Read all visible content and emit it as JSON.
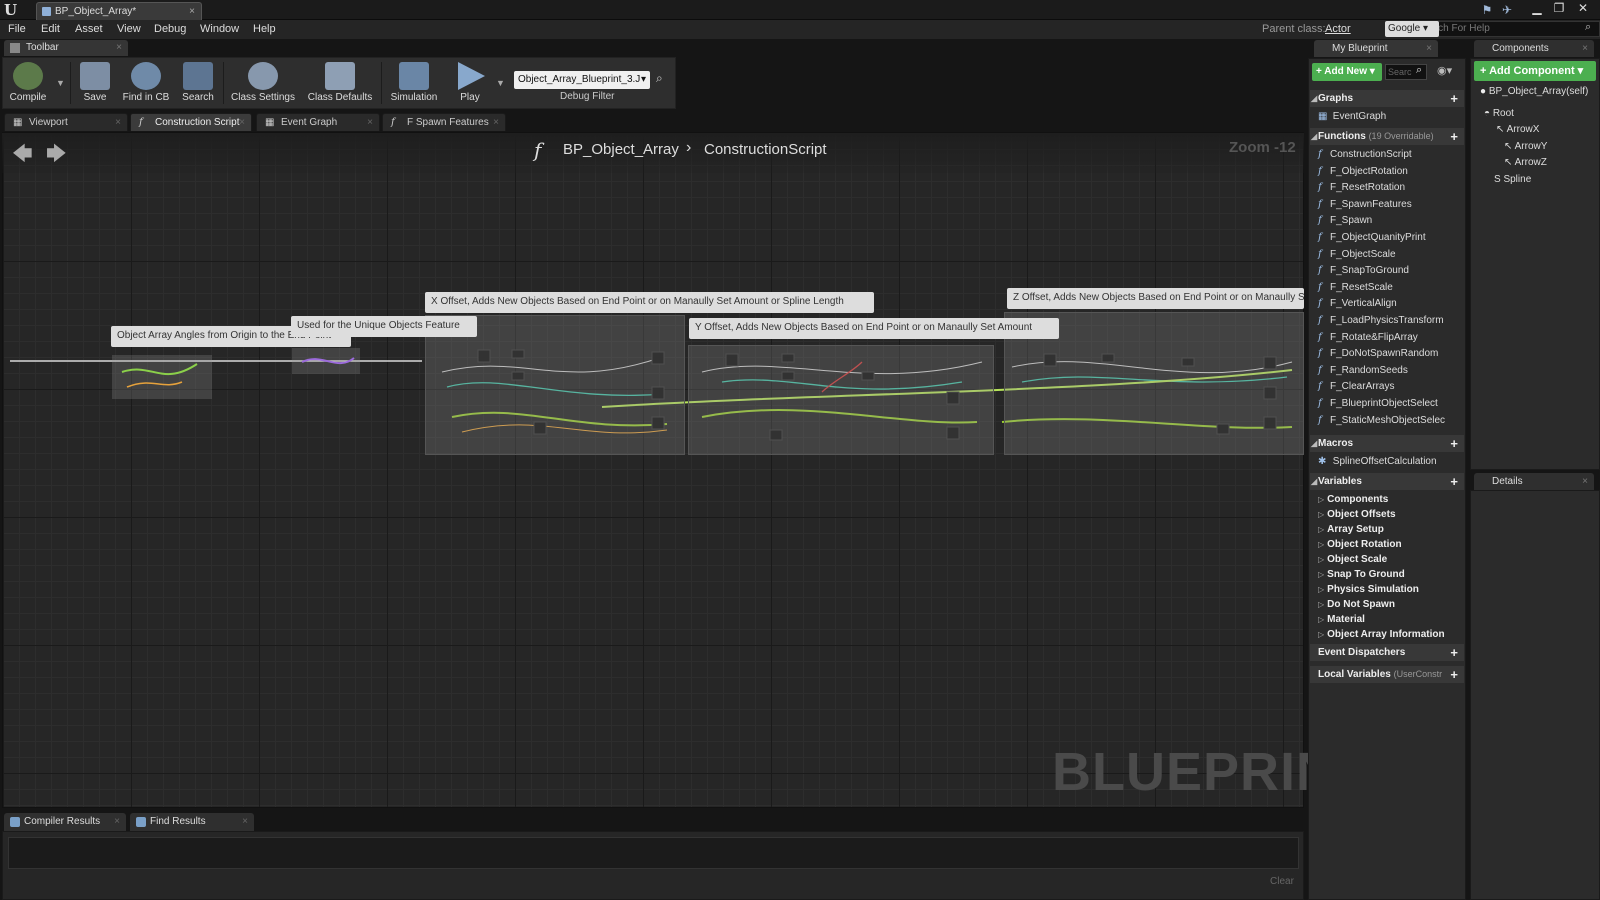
{
  "titlebar": {
    "doc_tab": "BP_Object_Array*",
    "doc_tab_close": "×",
    "minimize": "▁",
    "restore": "❐",
    "close": "✕"
  },
  "menu": [
    "File",
    "Edit",
    "Asset",
    "View",
    "Debug",
    "Window",
    "Help"
  ],
  "parent_class": {
    "label": "Parent class:",
    "value": "Actor"
  },
  "search_engine": "Google ▾",
  "help_search_placeholder": "Search For Help",
  "toolbar_tab": "Toolbar",
  "toolbar": {
    "compile": "Compile",
    "save": "Save",
    "find_in_cb": "Find in CB",
    "search": "Search",
    "class_settings": "Class Settings",
    "class_defaults": "Class Defaults",
    "simulation": "Simulation",
    "play": "Play",
    "debug_object": "Object_Array_Blueprint_3.J",
    "debug_filter": "Debug Filter"
  },
  "doc_tabs": [
    {
      "label": "Viewport",
      "icon": "viewport-icon"
    },
    {
      "label": "Construction Script",
      "icon": "function-icon"
    },
    {
      "label": "Event Graph",
      "icon": "graph-icon"
    },
    {
      "label": "F Spawn Features",
      "icon": "function-icon"
    }
  ],
  "graph": {
    "blueprint_name": "BP_Object_Array",
    "function_name": "ConstructionScript",
    "zoom": "Zoom -12",
    "watermark": "BLUEPRINT",
    "comments": [
      "Object Array Angles from Origin to the End Point",
      "Used for the Unique Objects Feature",
      "X Offset, Adds New Objects Based on End Point or on Manaully Set Amount or Spline Length",
      "Y Offset, Adds New Objects Based on End Point or on Manaully Set Amount",
      "Z Offset, Adds New Objects Based on End Point or on Manaully Set Amount"
    ]
  },
  "bottom_tabs": [
    "Compiler Results",
    "Find Results"
  ],
  "bottom_clear": "Clear",
  "my_blueprint": {
    "tab": "My Blueprint",
    "add_new": "+ Add New ▾",
    "search_placeholder": "Searc",
    "graphs_header": "Graphs",
    "graphs": [
      "EventGraph"
    ],
    "functions_header": "Functions",
    "functions_sub": "(19 Overridable)",
    "functions": [
      "ConstructionScript",
      "F_ObjectRotation",
      "F_ResetRotation",
      "F_SpawnFeatures",
      "F_Spawn",
      "F_ObjectQuanityPrint",
      "F_ObjectScale",
      "F_SnapToGround",
      "F_ResetScale",
      "F_VerticalAlign",
      "F_LoadPhysicsTransform",
      "F_Rotate&FlipArray",
      "F_DoNotSpawnRandom",
      "F_RandomSeeds",
      "F_ClearArrays",
      "F_BlueprintObjectSelect",
      "F_StaticMeshObjectSelec"
    ],
    "macros_header": "Macros",
    "macros": [
      "SplineOffsetCalculation"
    ],
    "variables_header": "Variables",
    "variables": [
      "Components",
      "Object Offsets",
      "Array Setup",
      "Object Rotation",
      "Object Scale",
      "Snap To Ground",
      "Physics Simulation",
      "Do Not Spawn",
      "Material",
      "Object Array Information"
    ],
    "event_dispatchers": "Event Dispatchers",
    "local_variables": "Local Variables",
    "local_variables_sub": "(UserConstr"
  },
  "components": {
    "tab": "Components",
    "add": "+ Add Component ▾",
    "self": "BP_Object_Array(self)",
    "root": "Root",
    "children": [
      "ArrowX",
      "ArrowY",
      "ArrowZ",
      "Spline"
    ]
  },
  "details_tab": "Details",
  "colors": {
    "accent_green": "#4caf50",
    "panel": "#2b2b2b",
    "graph_bg": "#262626"
  }
}
